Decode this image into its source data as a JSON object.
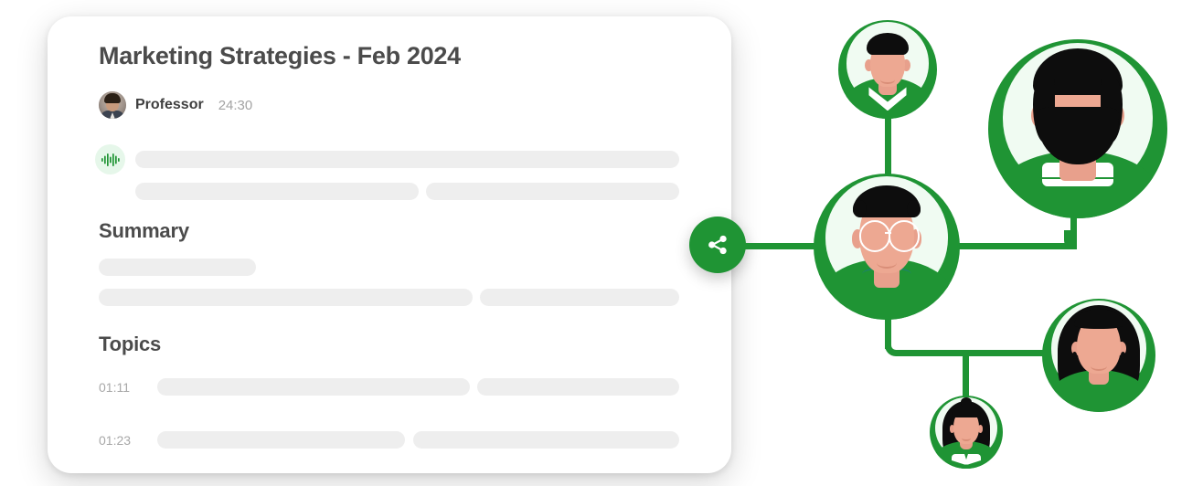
{
  "card": {
    "title": "Marketing Strategies - Feb 2024",
    "speaker": {
      "name": "Professor",
      "duration": "24:30",
      "avatar_icon": "user-photo-avatar"
    },
    "transcript_icon": "audio-waveform-icon",
    "sections": [
      {
        "heading": "Summary"
      },
      {
        "heading": "Topics"
      }
    ],
    "topics": [
      {
        "time": "01:11"
      },
      {
        "time": "01:23"
      }
    ]
  },
  "share_button": {
    "icon": "share-nodes-icon",
    "color": "#1f9434"
  },
  "network": {
    "accent_color": "#1f9434",
    "light_color": "#f0fbf2",
    "nodes": [
      {
        "id": "person-top-left",
        "icon": "avatar-collared-shirt"
      },
      {
        "id": "person-bearded",
        "icon": "avatar-bearded-man"
      },
      {
        "id": "person-center",
        "icon": "avatar-man-glasses"
      },
      {
        "id": "person-right",
        "icon": "avatar-long-hair-woman"
      },
      {
        "id": "person-bottom",
        "icon": "avatar-bun-hair-girl"
      }
    ]
  },
  "colors": {
    "skeleton": "#eeeeee",
    "title_text": "#4b4b4b",
    "muted_text": "#a8a8a8"
  }
}
